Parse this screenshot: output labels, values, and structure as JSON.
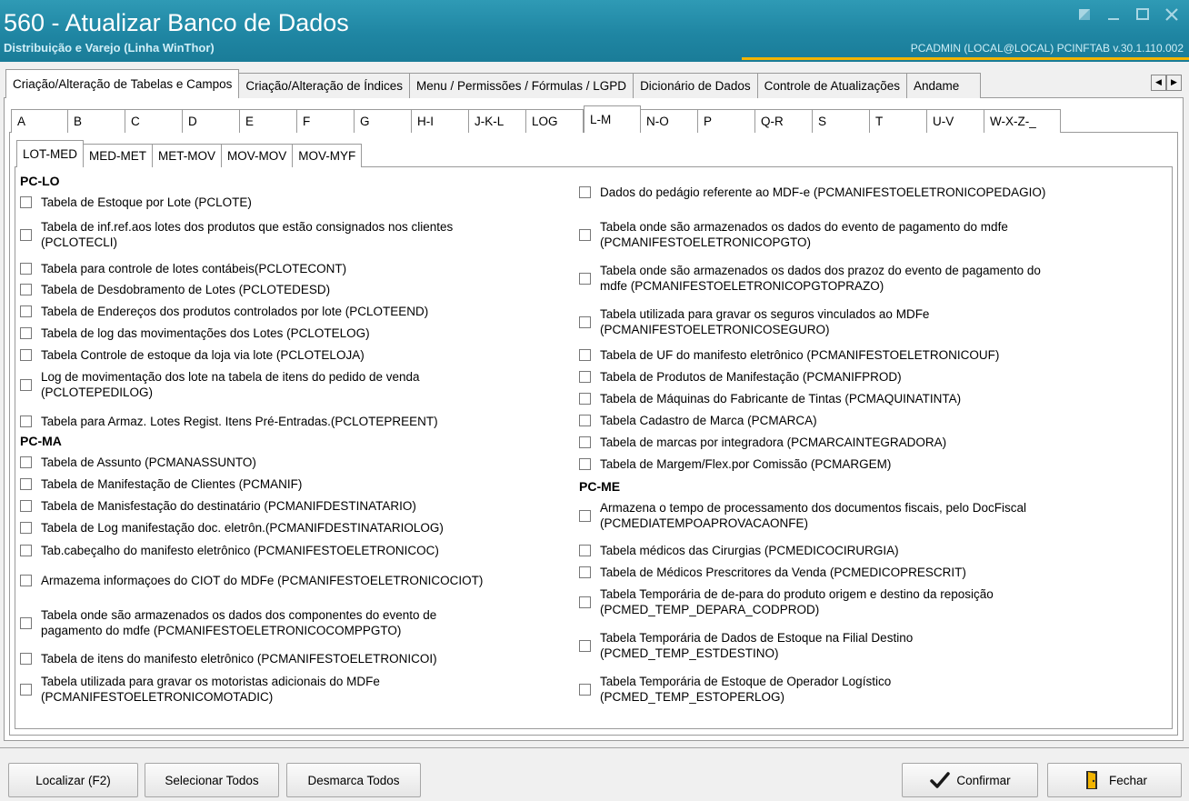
{
  "window": {
    "title": "560 - Atualizar Banco de Dados",
    "subtitle": "Distribuição e Varejo (Linha WinThor)",
    "user_info": "PCADMIN (LOCAL@LOCAL)   PCINFTAB  v.30.1.110.002"
  },
  "tabs_outer": [
    "Criação/Alteração de Tabelas e Campos",
    "Criação/Alteração de Índices",
    "Menu / Permissões / Fórmulas / LGPD",
    "Dicionário de Dados",
    "Controle de Atualizações",
    "Andame"
  ],
  "tabs_letters": [
    "A",
    "B",
    "C",
    "D",
    "E",
    "F",
    "G",
    "H-I",
    "J-K-L",
    "LOG",
    "L-M",
    "N-O",
    "P",
    "Q-R",
    "S",
    "T",
    "U-V",
    "W-X-Z-_"
  ],
  "tabs_sub": [
    "LOT-MED",
    "MED-MET",
    "MET-MOV",
    "MOV-MOV",
    "MOV-MYF"
  ],
  "groups": {
    "lo": "PC-LO",
    "ma": "PC-MA",
    "me": "PC-ME"
  },
  "left_items": [
    "Tabela de Estoque por Lote (PCLOTE)",
    "Tabela de inf.ref.aos lotes dos produtos que estão consignados nos clientes\n(PCLOTECLI)",
    "Tabela para controle de lotes contábeis(PCLOTECONT)",
    "Tabela de Desdobramento de Lotes (PCLOTEDESD)",
    "Tabela de Endereços dos produtos controlados por lote (PCLOTEEND)",
    "Tabela de log das movimentações dos Lotes (PCLOTELOG)",
    "Tabela Controle de estoque da loja via lote (PCLOTELOJA)",
    "Log de movimentação dos lote na tabela de itens do pedido de venda\n(PCLOTEPEDILOG)",
    "Tabela para Armaz. Lotes Regist. Itens Pré-Entradas.(PCLOTEPREENT)",
    "Tabela de Assunto  (PCMANASSUNTO)",
    "Tabela de Manifestação de Clientes (PCMANIF)",
    "Tabela de Manisfestação do destinatário (PCMANIFDESTINATARIO)",
    "Tabela de Log  manifestação doc. eletrôn.(PCMANIFDESTINATARIOLOG)",
    "Tab.cabeçalho do manifesto eletrônico (PCMANIFESTOELETRONICOC)",
    "Armazema informaçoes do CIOT do MDFe (PCMANIFESTOELETRONICOCIOT)",
    "Tabela onde são armazenados os dados dos componentes do evento de\npagamento do mdfe (PCMANIFESTOELETRONICOCOMPPGTO)",
    "Tabela de itens do manifesto eletrônico (PCMANIFESTOELETRONICOI)",
    "Tabela utilizada para gravar os motoristas adicionais do MDFe\n(PCMANIFESTOELETRONICOMOTADIC)"
  ],
  "right_items": [
    "Dados do pedágio referente ao MDF-e (PCMANIFESTOELETRONICOPEDAGIO)",
    "Tabela onde são armazenados os dados do evento de pagamento do mdfe\n(PCMANIFESTOELETRONICOPGTO)",
    "Tabela onde são armazenados os dados dos prazoz do evento de pagamento do\nmdfe (PCMANIFESTOELETRONICOPGTOPRAZO)",
    "Tabela utilizada para gravar os seguros vinculados ao MDFe\n(PCMANIFESTOELETRONICOSEGURO)",
    "Tabela de UF do manifesto eletrônico (PCMANIFESTOELETRONICOUF)",
    "Tabela de Produtos de Manifestação  (PCMANIFPROD)",
    "Tabela de Máquinas do Fabricante de Tintas (PCMAQUINATINTA)",
    "Tabela Cadastro de Marca  (PCMARCA)",
    "Tabela de marcas por integradora (PCMARCAINTEGRADORA)",
    "Tabela de Margem/Flex.por Comissão (PCMARGEM)",
    "Armazena o tempo de processamento dos documentos fiscais, pelo DocFiscal\n(PCMEDIATEMPOAPROVACAONFE)",
    "Tabela médicos das Cirurgias (PCMEDICOCIRURGIA)",
    "Tabela de Médicos Prescritores da Venda (PCMEDICOPRESCRIT)",
    "Tabela Temporária de de-para do produto origem e destino da reposição\n(PCMED_TEMP_DEPARA_CODPROD)",
    "Tabela Temporária de Dados de Estoque na Filial Destino\n(PCMED_TEMP_ESTDESTINO)",
    "Tabela Temporária de Estoque de Operador Logístico\n(PCMED_TEMP_ESTOPERLOG)"
  ],
  "buttons": {
    "localizar": "Localizar (F2)",
    "selecionar": "Selecionar Todos",
    "desmarca": "Desmarca Todos",
    "confirmar": "Confirmar",
    "fechar": "Fechar"
  },
  "colors": {
    "titlebar": "#1f86a3",
    "accent": "#f2b400",
    "confirm_check": "#1a1a1a"
  }
}
